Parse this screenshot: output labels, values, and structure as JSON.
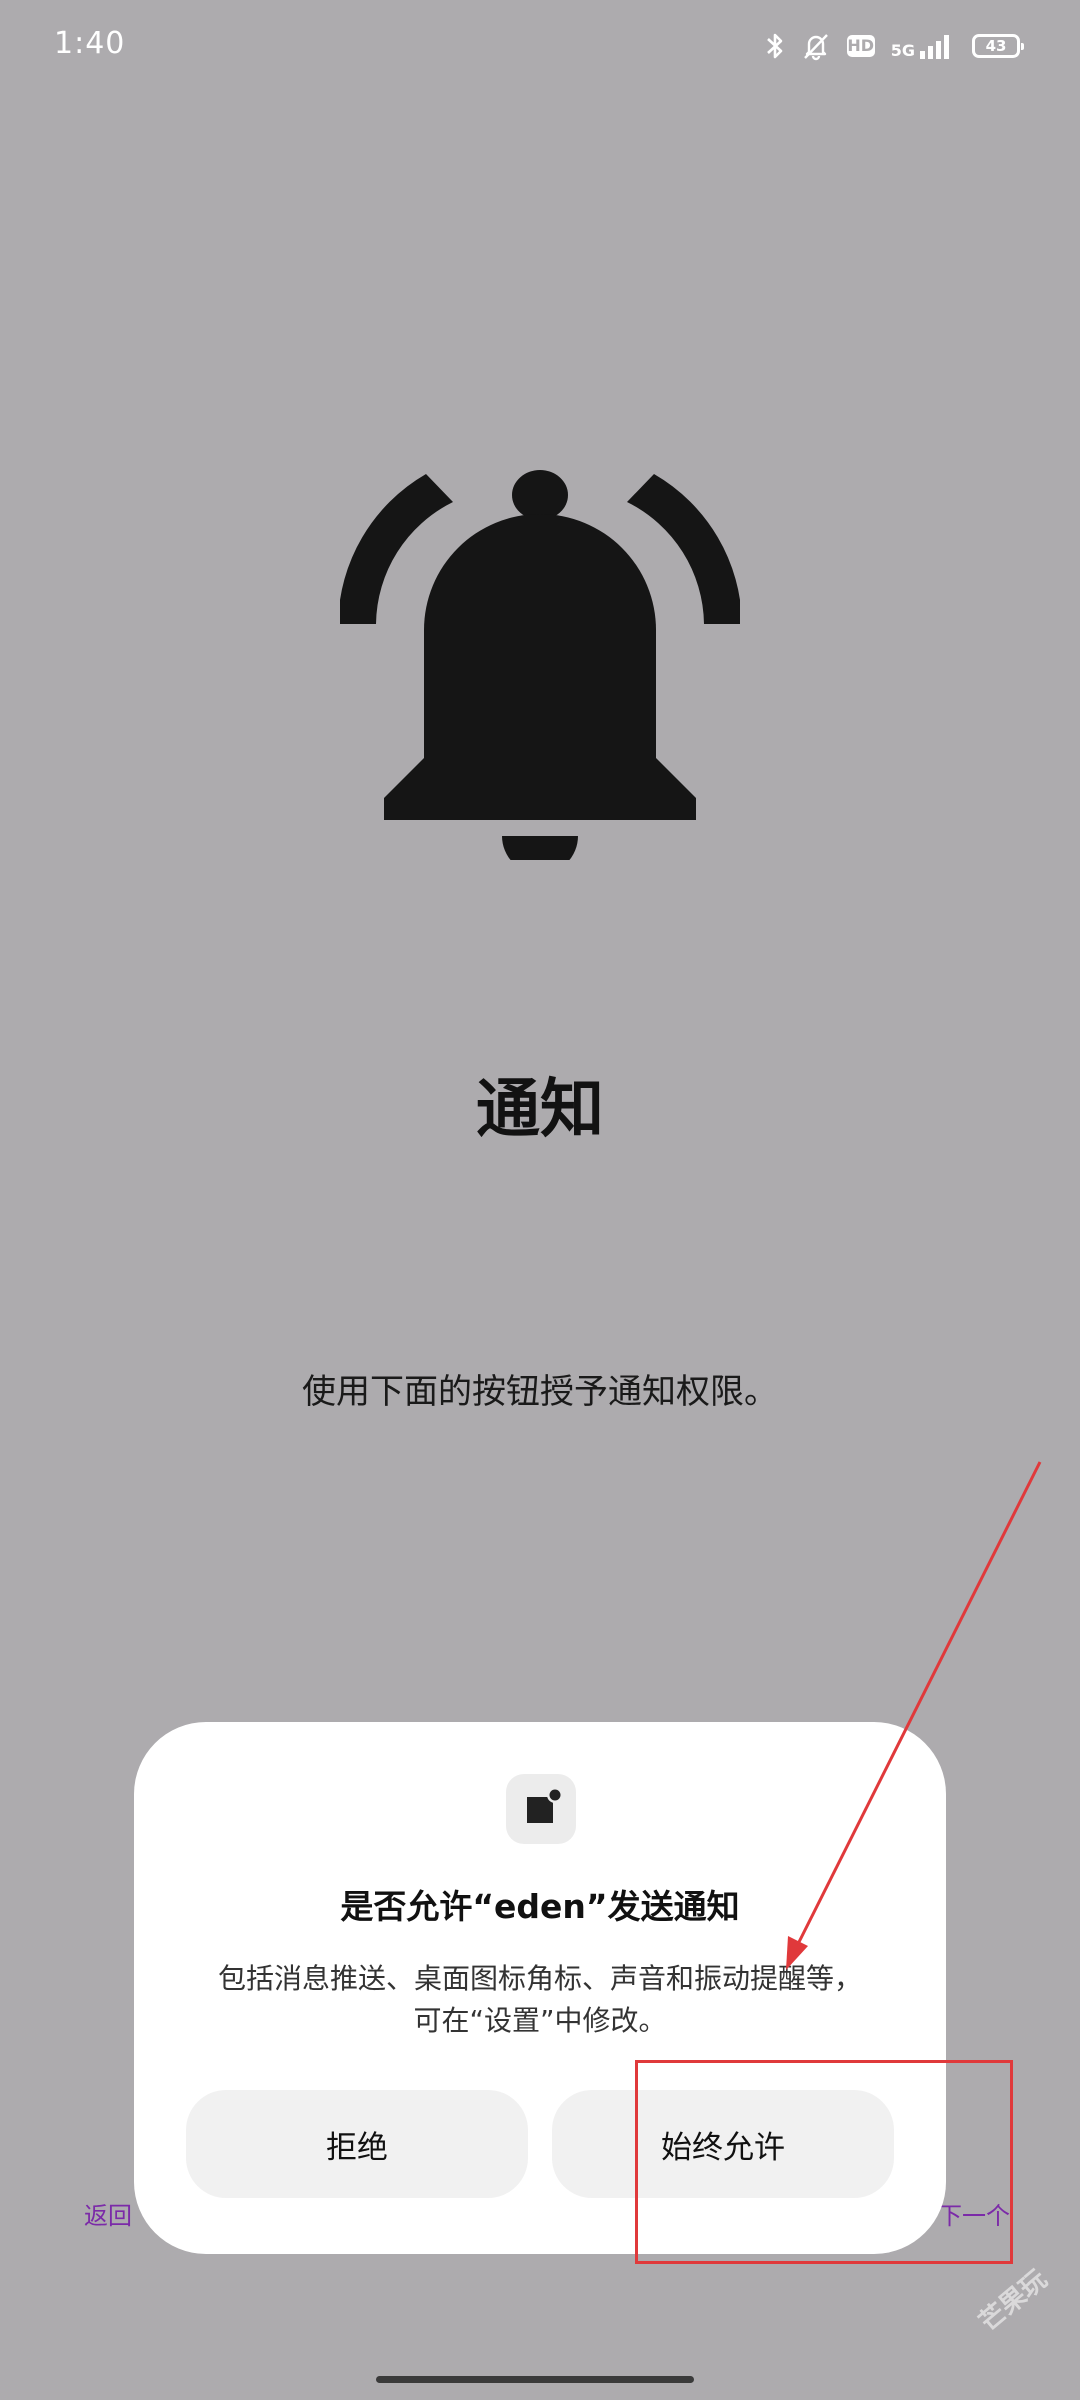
{
  "status_bar": {
    "time": "1:40",
    "icons": [
      "bluetooth-icon",
      "mute-bell-icon",
      "hd-icon",
      "signal-5g-icon",
      "battery-icon"
    ],
    "hd_label": "HD",
    "network_label": "5G",
    "battery_level": "43"
  },
  "page": {
    "title": "通知",
    "description": "使用下面的按钮授予通知权限。",
    "background_color": "#adabae"
  },
  "nav": {
    "back_label": "返回",
    "next_label": "下一个"
  },
  "dialog": {
    "title": "是否允许“eden”发送通知",
    "body_line1": "包括消息推送、桌面图标角标、声音和振动提醒等，",
    "body_line2": "可在“设置”中修改。",
    "deny_label": "拒绝",
    "allow_label": "始终允许"
  },
  "annotation": {
    "color": "#e0393b"
  },
  "watermark": {
    "text": "芒果玩"
  }
}
